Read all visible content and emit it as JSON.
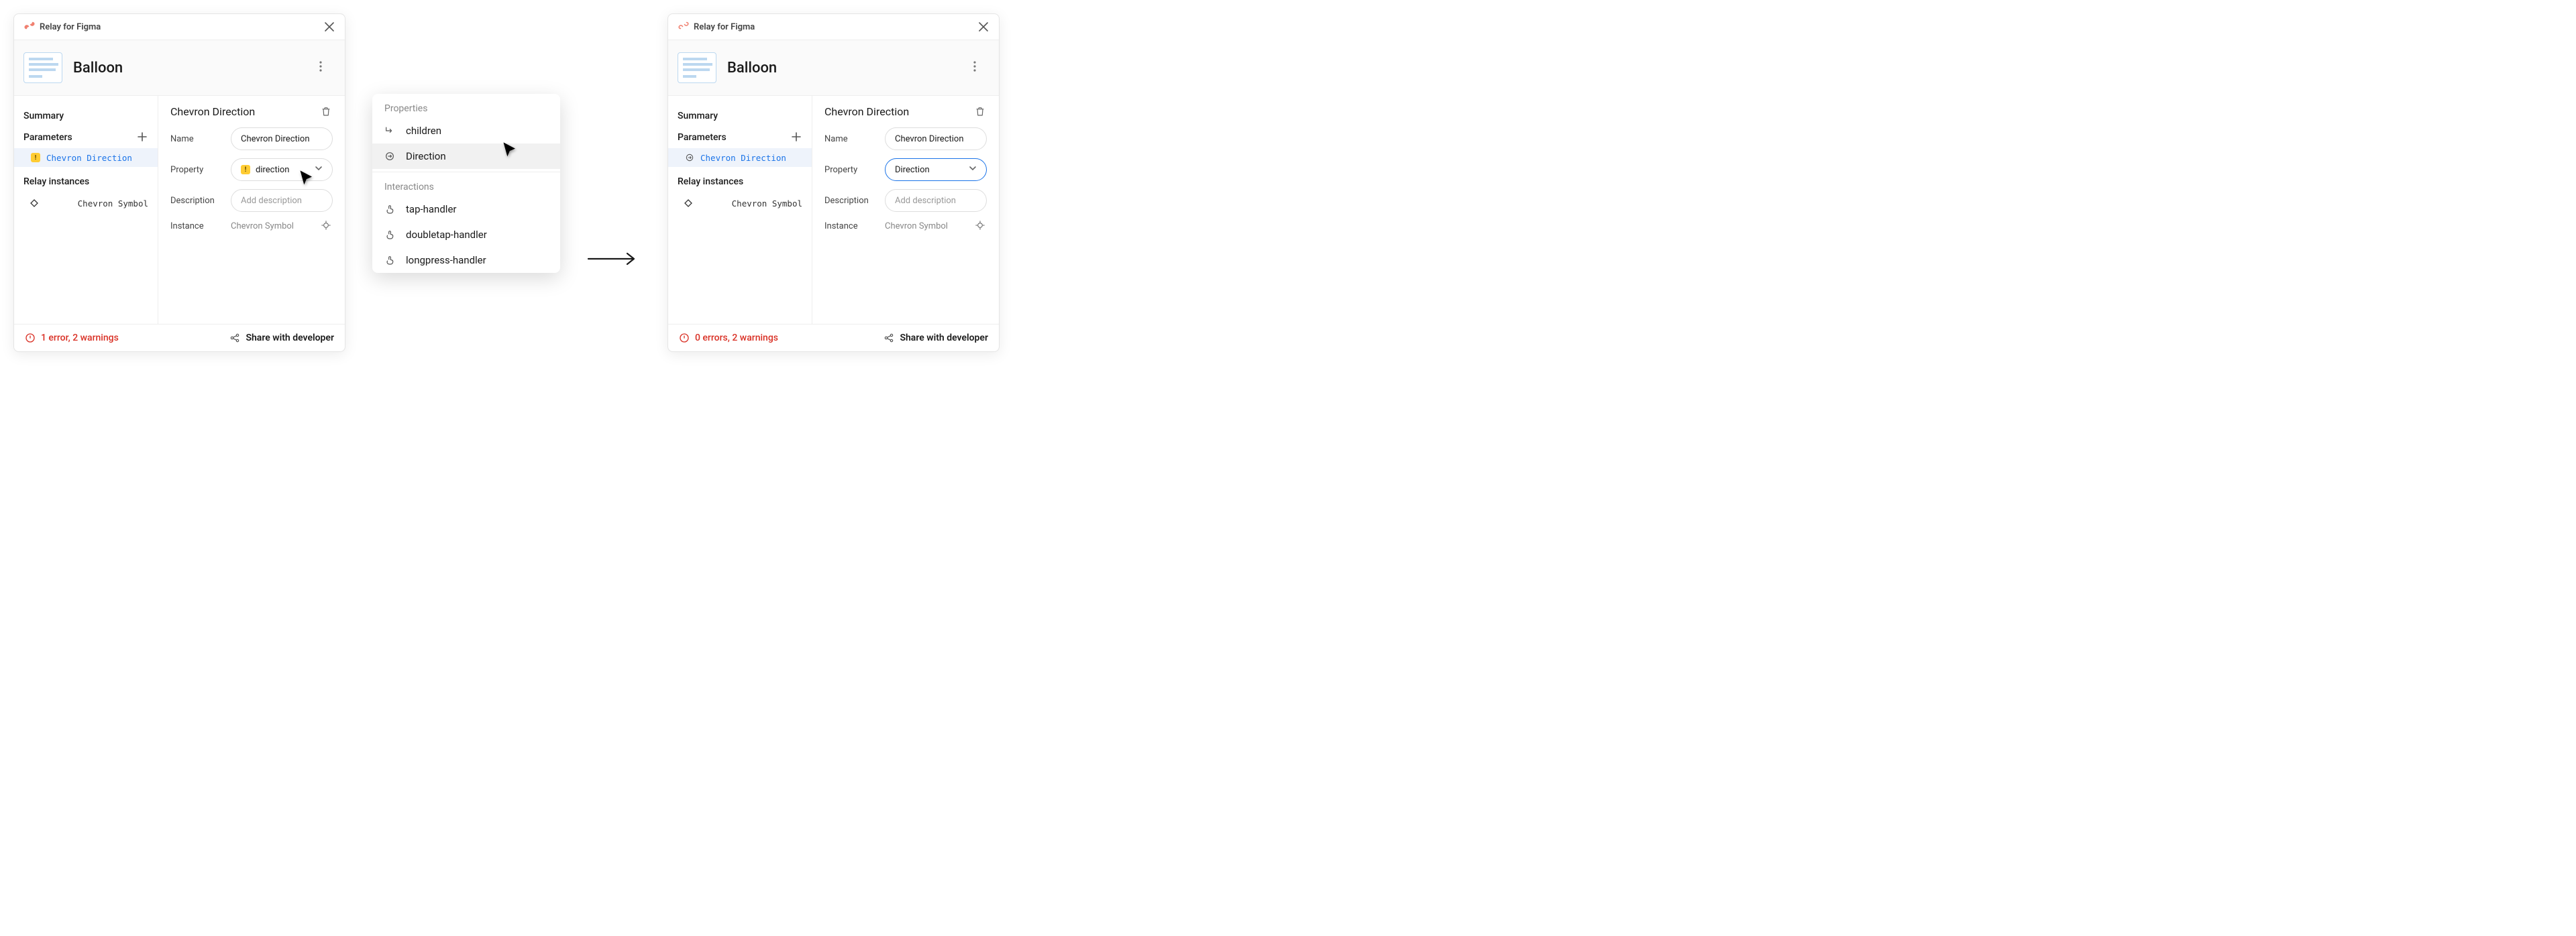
{
  "app": {
    "name": "Relay for Figma"
  },
  "left": {
    "component": "Balloon",
    "sidebar": {
      "summary": "Summary",
      "parameters_label": "Parameters",
      "param": "Chevron Direction",
      "param_warning": true,
      "relay_instances_label": "Relay instances",
      "instance": "Chevron Symbol"
    },
    "form": {
      "title": "Chevron Direction",
      "name_label": "Name",
      "name_value": "Chevron Direction",
      "property_label": "Property",
      "property_value": "direction",
      "property_warning": true,
      "description_label": "Description",
      "description_placeholder": "Add description",
      "instance_label": "Instance",
      "instance_value": "Chevron Symbol"
    },
    "status": "1 error, 2 warnings",
    "share": "Share with developer"
  },
  "menu": {
    "properties_label": "Properties",
    "children": "children",
    "direction": "Direction",
    "interactions_label": "Interactions",
    "tap": "tap-handler",
    "doubletap": "doubletap-handler",
    "longpress": "longpress-handler"
  },
  "right": {
    "component": "Balloon",
    "sidebar": {
      "summary": "Summary",
      "parameters_label": "Parameters",
      "param": "Chevron Direction",
      "param_warning": false,
      "relay_instances_label": "Relay instances",
      "instance": "Chevron Symbol"
    },
    "form": {
      "title": "Chevron Direction",
      "name_label": "Name",
      "name_value": "Chevron Direction",
      "property_label": "Property",
      "property_value": "Direction",
      "description_label": "Description",
      "description_placeholder": "Add description",
      "instance_label": "Instance",
      "instance_value": "Chevron Symbol"
    },
    "status": "0 errors, 2 warnings",
    "share": "Share with developer"
  }
}
